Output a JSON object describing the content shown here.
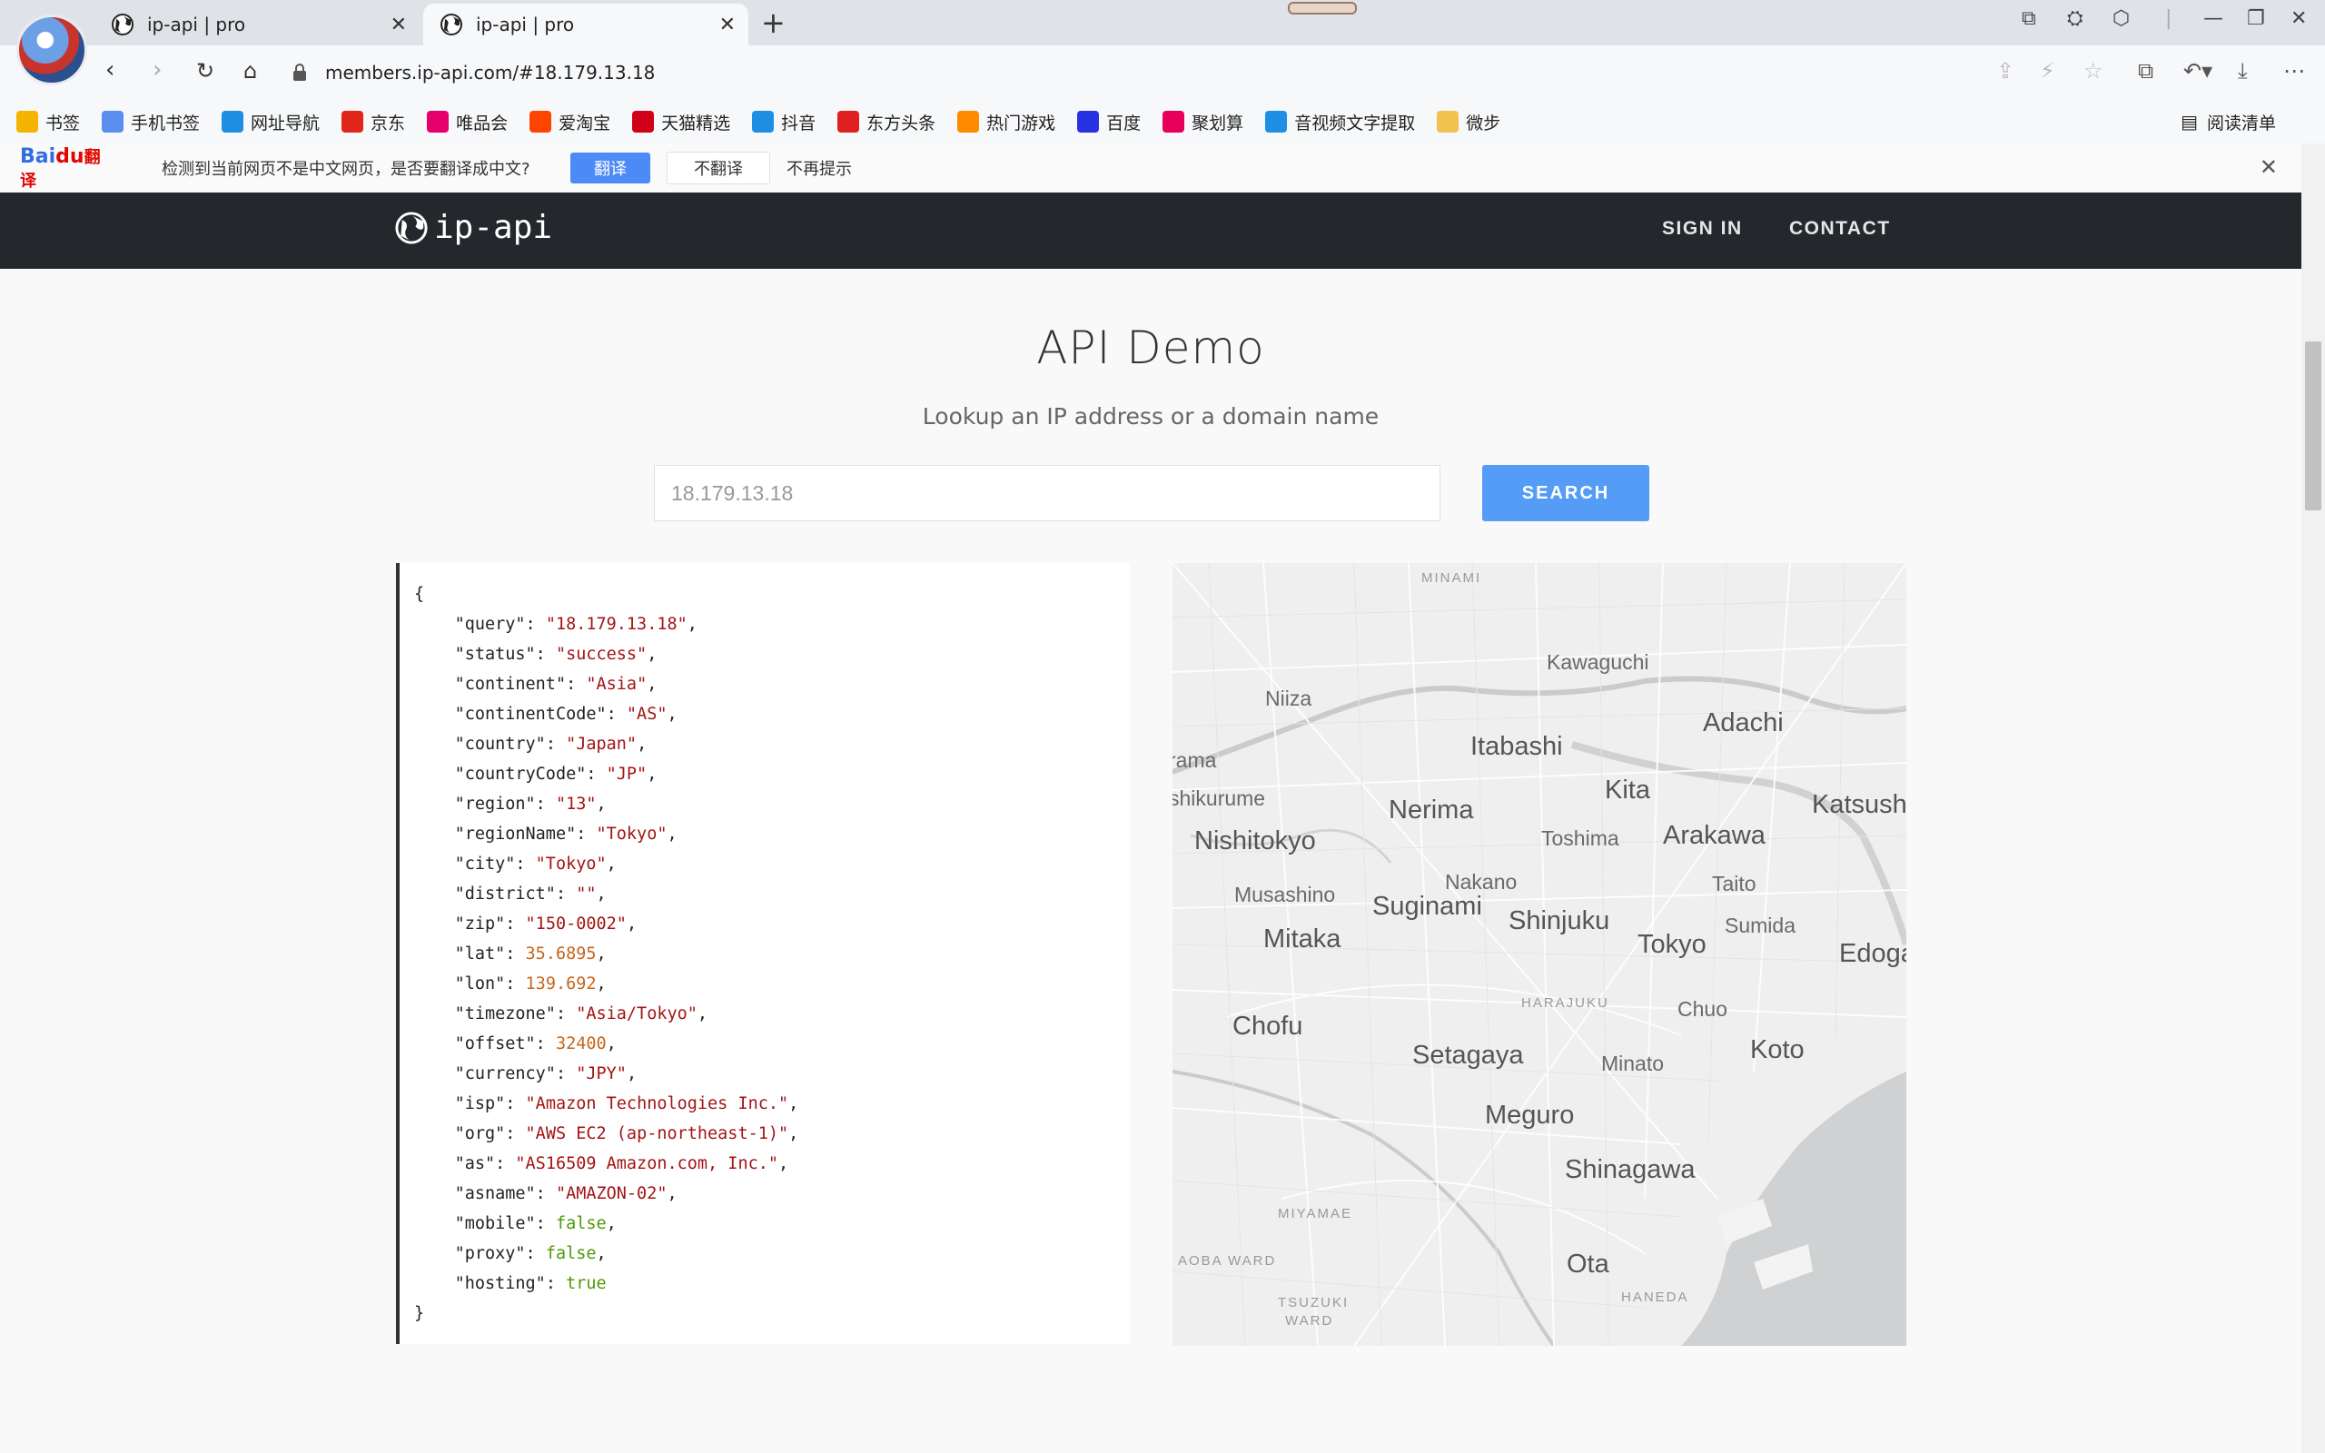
{
  "browser": {
    "tabs": [
      {
        "title": "ip-api | pro",
        "active": false
      },
      {
        "title": "ip-api | pro",
        "active": true
      }
    ],
    "new_tab_symbol": "+",
    "url": "members.ip-api.com/#18.179.13.18",
    "bookmarks": [
      {
        "label": "书签",
        "icon": "star-icon",
        "color": "#f5b400"
      },
      {
        "label": "手机书签",
        "icon": "phone-icon",
        "color": "#5b8def"
      },
      {
        "label": "网址导航",
        "icon": "edge-icon",
        "color": "#1f8fe6"
      },
      {
        "label": "京东",
        "icon": "jd-icon",
        "color": "#e1251b"
      },
      {
        "label": "唯品会",
        "icon": "vip-icon",
        "color": "#e6006e"
      },
      {
        "label": "爱淘宝",
        "icon": "taobao-icon",
        "color": "#ff4400"
      },
      {
        "label": "天猫精选",
        "icon": "tmall-icon",
        "color": "#d1001a"
      },
      {
        "label": "抖音",
        "icon": "edge-icon",
        "color": "#1f8fe6"
      },
      {
        "label": "东方头条",
        "icon": "toutiao-icon",
        "color": "#e02020"
      },
      {
        "label": "热门游戏",
        "icon": "game-icon",
        "color": "#ff8a00"
      },
      {
        "label": "百度",
        "icon": "baidu-paw-icon",
        "color": "#2932e1"
      },
      {
        "label": "聚划算",
        "icon": "juhuasuan-icon",
        "color": "#e6005c"
      },
      {
        "label": "音视频文字提取",
        "icon": "edge-icon",
        "color": "#1f8fe6"
      },
      {
        "label": "微步",
        "icon": "folder-icon",
        "color": "#f2c14e"
      }
    ],
    "reading_list": "阅读清单"
  },
  "translate_bar": {
    "logo_main": "Bai",
    "logo_accent": "du",
    "logo_suffix": "翻译",
    "message": "检测到当前网页不是中文网页，是否要翻译成中文?",
    "translate": "翻译",
    "no_translate": "不翻译",
    "never": "不再提示"
  },
  "site": {
    "logo_text": "ip-api",
    "nav": {
      "sign_in": "SIGN IN",
      "contact": "CONTACT"
    }
  },
  "demo": {
    "title": "API Demo",
    "subtitle": "Lookup an IP address or a domain name",
    "search_value": "18.179.13.18",
    "search_button": "SEARCH"
  },
  "json_result": [
    {
      "key": "query",
      "value": "\"18.179.13.18\"",
      "type": "string"
    },
    {
      "key": "status",
      "value": "\"success\"",
      "type": "string"
    },
    {
      "key": "continent",
      "value": "\"Asia\"",
      "type": "string"
    },
    {
      "key": "continentCode",
      "value": "\"AS\"",
      "type": "string"
    },
    {
      "key": "country",
      "value": "\"Japan\"",
      "type": "string"
    },
    {
      "key": "countryCode",
      "value": "\"JP\"",
      "type": "string"
    },
    {
      "key": "region",
      "value": "\"13\"",
      "type": "string"
    },
    {
      "key": "regionName",
      "value": "\"Tokyo\"",
      "type": "string"
    },
    {
      "key": "city",
      "value": "\"Tokyo\"",
      "type": "string"
    },
    {
      "key": "district",
      "value": "\"\"",
      "type": "string"
    },
    {
      "key": "zip",
      "value": "\"150-0002\"",
      "type": "string"
    },
    {
      "key": "lat",
      "value": "35.6895",
      "type": "number"
    },
    {
      "key": "lon",
      "value": "139.692",
      "type": "number"
    },
    {
      "key": "timezone",
      "value": "\"Asia/Tokyo\"",
      "type": "string"
    },
    {
      "key": "offset",
      "value": "32400",
      "type": "number"
    },
    {
      "key": "currency",
      "value": "\"JPY\"",
      "type": "string"
    },
    {
      "key": "isp",
      "value": "\"Amazon Technologies Inc.\"",
      "type": "string"
    },
    {
      "key": "org",
      "value": "\"AWS EC2 (ap-northeast-1)\"",
      "type": "string"
    },
    {
      "key": "as",
      "value": "\"AS16509 Amazon.com, Inc.\"",
      "type": "string"
    },
    {
      "key": "asname",
      "value": "\"AMAZON-02\"",
      "type": "string"
    },
    {
      "key": "mobile",
      "value": "false",
      "type": "bool"
    },
    {
      "key": "proxy",
      "value": "false",
      "type": "bool"
    },
    {
      "key": "hosting",
      "value": "true",
      "type": "bool"
    }
  ],
  "json_open": "{",
  "json_close": "}",
  "map": {
    "labels": [
      {
        "text": "MINAMI",
        "size": "small"
      },
      {
        "text": "Kawaguchi",
        "size": "mid"
      },
      {
        "text": "Niiza",
        "size": "mid"
      },
      {
        "text": "Adachi",
        "size": "big"
      },
      {
        "text": "Itabashi",
        "size": "big"
      },
      {
        "text": "rama",
        "size": "mid"
      },
      {
        "text": "Kita",
        "size": "big"
      },
      {
        "text": "shikurume",
        "size": "mid"
      },
      {
        "text": "Nerima",
        "size": "big"
      },
      {
        "text": "Katsush",
        "size": "big"
      },
      {
        "text": "Nishitokyo",
        "size": "big"
      },
      {
        "text": "Toshima",
        "size": "mid"
      },
      {
        "text": "Arakawa",
        "size": "big"
      },
      {
        "text": "Nakano",
        "size": "mid"
      },
      {
        "text": "Taito",
        "size": "mid"
      },
      {
        "text": "Musashino",
        "size": "mid"
      },
      {
        "text": "Suginami",
        "size": "big"
      },
      {
        "text": "Sumida",
        "size": "mid"
      },
      {
        "text": "Shinjuku",
        "size": "big"
      },
      {
        "text": "Mitaka",
        "size": "big"
      },
      {
        "text": "Tokyo",
        "size": "big"
      },
      {
        "text": "Edoga",
        "size": "big"
      },
      {
        "text": "HARAJUKU",
        "size": "small"
      },
      {
        "text": "Chuo",
        "size": "mid"
      },
      {
        "text": "Chofu",
        "size": "big"
      },
      {
        "text": "Koto",
        "size": "big"
      },
      {
        "text": "Setagaya",
        "size": "big"
      },
      {
        "text": "Minato",
        "size": "mid"
      },
      {
        "text": "Meguro",
        "size": "big"
      },
      {
        "text": "Shinagawa",
        "size": "big"
      },
      {
        "text": "MIYAMAE",
        "size": "small"
      },
      {
        "text": "AOBA WARD",
        "size": "small"
      },
      {
        "text": "Ota",
        "size": "big"
      },
      {
        "text": "TSUZUKI",
        "size": "small"
      },
      {
        "text": "WARD",
        "size": "small"
      },
      {
        "text": "HANEDA",
        "size": "small"
      }
    ]
  }
}
